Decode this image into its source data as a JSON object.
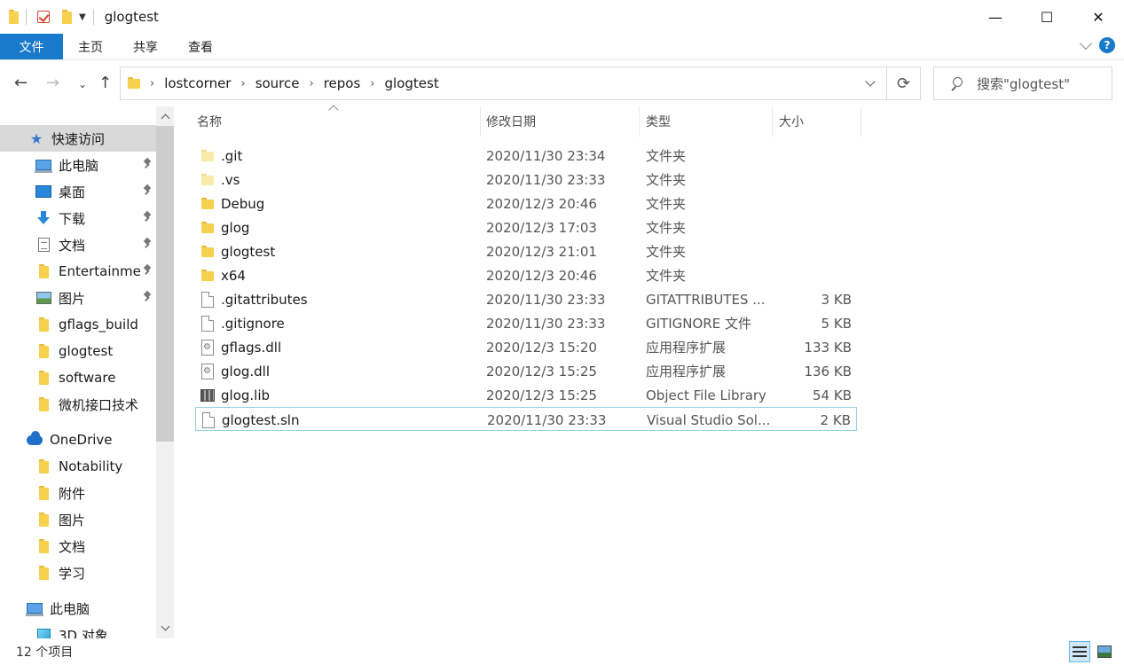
{
  "window": {
    "title": "glogtest",
    "controls": {
      "minimize": "—",
      "maximize": "☐",
      "close": "✕"
    }
  },
  "ribbon": {
    "tabs": [
      "文件",
      "主页",
      "共享",
      "查看"
    ],
    "help": "?"
  },
  "address": {
    "crumbs": [
      "lostcorner",
      "source",
      "repos",
      "glogtest"
    ],
    "search_placeholder": "搜索\"glogtest\""
  },
  "sidebar": {
    "items": [
      {
        "label": "快速访问",
        "icon": "star-icon",
        "pinned": false,
        "active": true
      },
      {
        "label": "此电脑",
        "icon": "pc-icon",
        "pinned": true
      },
      {
        "label": "桌面",
        "icon": "desktop-icon",
        "pinned": true
      },
      {
        "label": "下载",
        "icon": "download-icon",
        "pinned": true
      },
      {
        "label": "文档",
        "icon": "document-icon",
        "pinned": true
      },
      {
        "label": "Entertainme",
        "icon": "folder-icon",
        "pinned": true
      },
      {
        "label": "图片",
        "icon": "picture-icon",
        "pinned": true
      },
      {
        "label": "gflags_build",
        "icon": "folder-icon"
      },
      {
        "label": "glogtest",
        "icon": "folder-icon"
      },
      {
        "label": "software",
        "icon": "folder-icon"
      },
      {
        "label": "微机接口技术",
        "icon": "folder-icon"
      },
      {
        "label": "OneDrive",
        "icon": "onedrive-icon"
      },
      {
        "label": "Notability",
        "icon": "folder-icon"
      },
      {
        "label": "附件",
        "icon": "folder-icon"
      },
      {
        "label": "图片",
        "icon": "folder-icon"
      },
      {
        "label": "文档",
        "icon": "folder-icon"
      },
      {
        "label": "学习",
        "icon": "folder-icon"
      },
      {
        "label": "此电脑",
        "icon": "pc-icon"
      },
      {
        "label": "3D 对象",
        "icon": "cube-icon"
      }
    ]
  },
  "columns": {
    "name": "名称",
    "date": "修改日期",
    "type": "类型",
    "size": "大小"
  },
  "files": [
    {
      "name": ".git",
      "date": "2020/11/30 23:34",
      "type": "文件夹",
      "size": "",
      "icon": "folder-pale"
    },
    {
      "name": ".vs",
      "date": "2020/11/30 23:33",
      "type": "文件夹",
      "size": "",
      "icon": "folder-pale"
    },
    {
      "name": "Debug",
      "date": "2020/12/3 20:46",
      "type": "文件夹",
      "size": "",
      "icon": "folder"
    },
    {
      "name": "glog",
      "date": "2020/12/3 17:03",
      "type": "文件夹",
      "size": "",
      "icon": "folder"
    },
    {
      "name": "glogtest",
      "date": "2020/12/3 21:01",
      "type": "文件夹",
      "size": "",
      "icon": "folder"
    },
    {
      "name": "x64",
      "date": "2020/12/3 20:46",
      "type": "文件夹",
      "size": "",
      "icon": "folder"
    },
    {
      "name": ".gitattributes",
      "date": "2020/11/30 23:33",
      "type": "GITATTRIBUTES ...",
      "size": "3 KB",
      "icon": "file"
    },
    {
      "name": ".gitignore",
      "date": "2020/11/30 23:33",
      "type": "GITIGNORE 文件",
      "size": "5 KB",
      "icon": "file"
    },
    {
      "name": "gflags.dll",
      "date": "2020/12/3 15:20",
      "type": "应用程序扩展",
      "size": "133 KB",
      "icon": "dll"
    },
    {
      "name": "glog.dll",
      "date": "2020/12/3 15:25",
      "type": "应用程序扩展",
      "size": "136 KB",
      "icon": "dll"
    },
    {
      "name": "glog.lib",
      "date": "2020/12/3 15:25",
      "type": "Object File Library",
      "size": "54 KB",
      "icon": "lib"
    },
    {
      "name": "glogtest.sln",
      "date": "2020/11/30 23:33",
      "type": "Visual Studio Sol...",
      "size": "2 KB",
      "icon": "file",
      "selected": true
    }
  ],
  "status": {
    "count": "12 个项目"
  },
  "colors": {
    "accent": "#1979ca",
    "selection_border": "#99d1e3",
    "folder": "#f7d04d"
  }
}
